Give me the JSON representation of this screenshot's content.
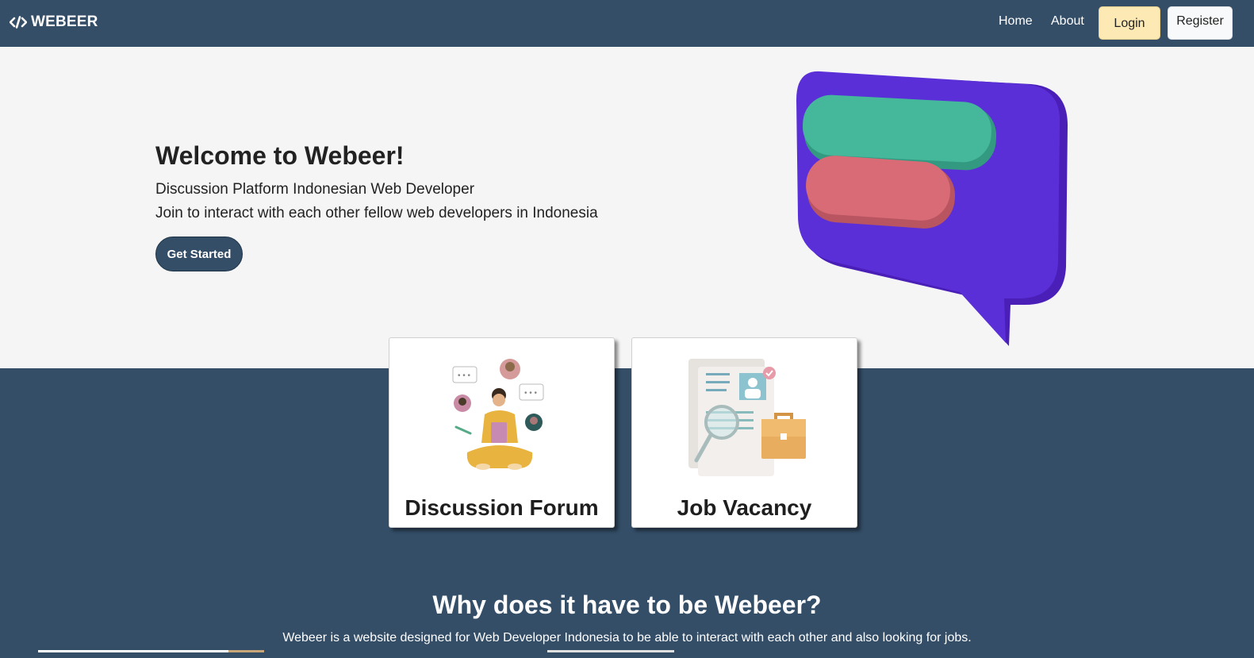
{
  "nav": {
    "brand": "WEBEER",
    "links": [
      "Home",
      "About"
    ],
    "login": "Login",
    "register": "Register"
  },
  "hero": {
    "title": "Welcome to Webeer!",
    "line1": "Discussion Platform Indonesian Web Developer",
    "line2": "Join to interact with each other fellow web developers in Indonesia",
    "cta": "Get Started"
  },
  "cards": [
    {
      "title": "Discussion Forum"
    },
    {
      "title": "Job Vacancy"
    }
  ],
  "why": {
    "title": "Why does it have to be Webeer?",
    "text": "Webeer is a website designed for Web Developer Indonesia to be able to interact with each other and also looking for jobs."
  },
  "colors": {
    "primary": "#344e68",
    "hero_bg": "#f5f5f5",
    "login_bg": "#fde9b3",
    "bubble": "#5b2fd8",
    "bar_green": "#45b89b",
    "bar_red": "#d86b75"
  }
}
